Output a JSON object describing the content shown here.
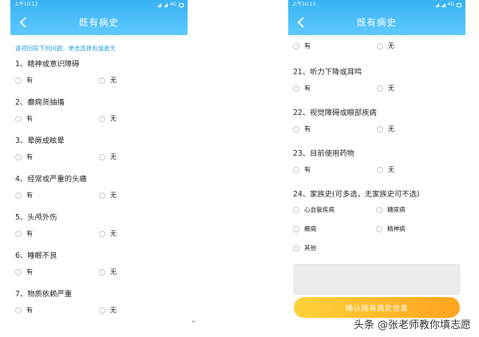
{
  "status_bar": {
    "time": "上午10:13",
    "network": "4G"
  },
  "header": {
    "title": "既有病史"
  },
  "hint": "逐项回答下列问题，单击选择有或者无",
  "options": {
    "yes": "有",
    "no": "无"
  },
  "left_questions": [
    {
      "title": "1、精神或意识障碍"
    },
    {
      "title": "2、癫痫货抽搐"
    },
    {
      "title": "3、晕厥或眩晕"
    },
    {
      "title": "4、经常或严重的头痛"
    },
    {
      "title": "5、头颅外伤"
    },
    {
      "title": "6、睡眠不良"
    },
    {
      "title": "7、物质依赖严重"
    }
  ],
  "right_questions": [
    {
      "title": "21、听力下降或耳鸣"
    },
    {
      "title": "22、视觉障碍或眼部疾病"
    },
    {
      "title": "23、目前使用药物"
    }
  ],
  "family_history": {
    "title": "24、家族史(可多选，无家族史可不选)",
    "options": [
      "心血管疾病",
      "糖尿病",
      "癫痫",
      "精神病",
      "其他"
    ]
  },
  "confirm_label": "确认既有病史信息",
  "watermark": "头条 @张老师教你填志愿"
}
